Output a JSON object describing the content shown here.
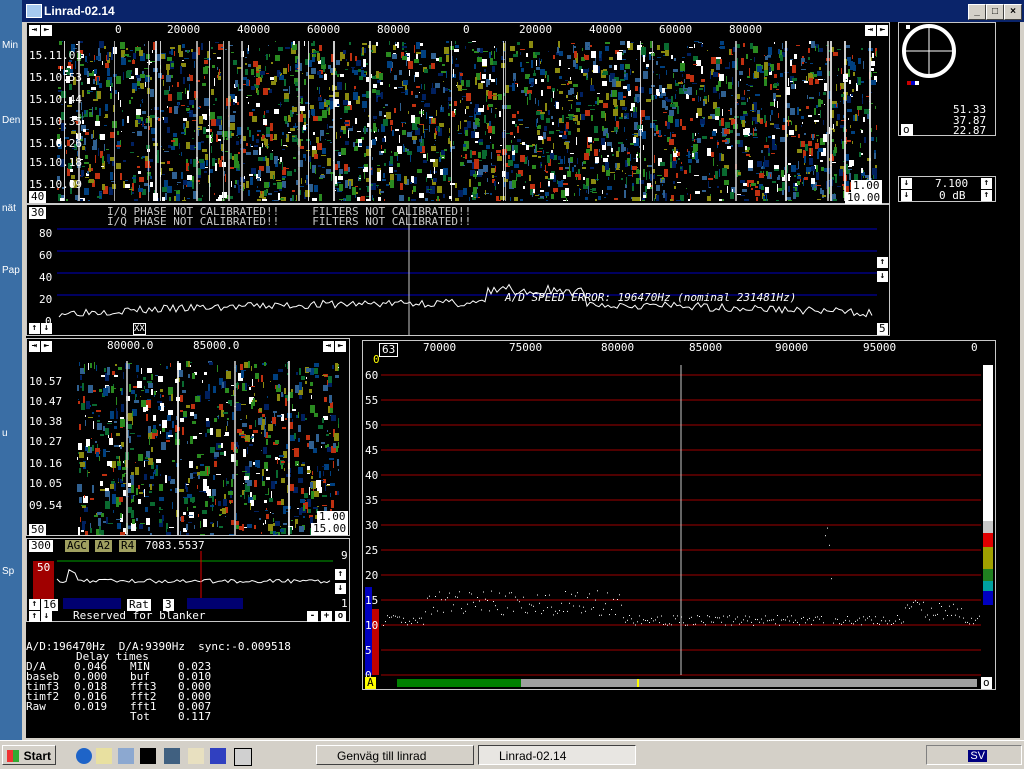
{
  "desktop_icons": [
    "Min",
    "Den",
    "nät",
    "Pap",
    "u",
    "Sp"
  ],
  "window": {
    "title": "Linrad-02.14"
  },
  "main_waterfall": {
    "freq_ticks": [
      "0",
      "20000",
      "40000",
      "60000",
      "80000",
      "0",
      "20000",
      "40000",
      "60000",
      "80000"
    ],
    "times": [
      "15.11.01",
      "15.10.53",
      "15.10.44",
      "15.10.35",
      "15.10.26",
      "15.10.18",
      "15.10.09"
    ],
    "left_box": "40",
    "right_box_top": "1.00",
    "right_box_bottom": "10.00"
  },
  "polar": {
    "values": [
      "51.33",
      "37.87",
      "22.87"
    ],
    "o_label": "o"
  },
  "gain_controls": {
    "row1": "7.100",
    "row2": "0 dB"
  },
  "spectrum": {
    "left_box": "30",
    "warning1": "I/Q PHASE NOT CALIBRATED!!     FILTERS NOT CALIBRATED!!",
    "warning2": "I/Q PHASE NOT CALIBRATED!!     FILTERS NOT CALIBRATED!!",
    "y_ticks": [
      "80",
      "60",
      "40",
      "20",
      "0"
    ],
    "speed_error": "A/D SPEED ERROR: 196470Hz (nominal 231481Hz)",
    "right_box": "5",
    "bottom_marker": "XX"
  },
  "small_waterfall": {
    "freq_ticks": [
      "80000.0",
      "85000.0"
    ],
    "times": [
      "10.57",
      "10.47",
      "10.38",
      "10.27",
      "10.16",
      "10.05",
      "09.54"
    ],
    "left_box": "50",
    "right_box_top": "1.00",
    "right_box_bottom": "15.00"
  },
  "baseband": {
    "box1": "300",
    "agc": "AGC",
    "a2": "A2",
    "r4": "R4",
    "freq": "7083.5537",
    "right_num": "9",
    "level": "50",
    "box_16": "16",
    "rat": "Rat",
    "rat_val": "3",
    "right_num2": "1",
    "reserved": "Reserved for blanker",
    "minus": "-",
    "plus": "+",
    "o": "o"
  },
  "stats": {
    "line1": "A/D:196470Hz  D/A:9390Hz  sync:-0.009518",
    "header": "Delay times",
    "rows": [
      [
        "D/A",
        "0.046",
        "MIN",
        "0.023"
      ],
      [
        "baseb",
        "0.000",
        "buf",
        "0.010"
      ],
      [
        "timf3",
        "0.018",
        "fft3",
        "0.000"
      ],
      [
        "timf2",
        "0.016",
        "fft2",
        "0.000"
      ],
      [
        "Raw",
        "0.019",
        "fft1",
        "0.007"
      ],
      [
        "",
        "",
        "Tot",
        "0.117"
      ]
    ]
  },
  "hires": {
    "top_box": "63",
    "freq_ticks": [
      "70000",
      "75000",
      "80000",
      "85000",
      "90000",
      "95000",
      "0"
    ],
    "y_ticks": [
      "60",
      "55",
      "50",
      "45",
      "40",
      "35",
      "30",
      "25",
      "20",
      "15",
      "10",
      "5",
      "0"
    ],
    "a_label": "A",
    "o_label": "o",
    "zero_label": "0"
  },
  "taskbar": {
    "start": "Start",
    "buttons": [
      "Genväg till linrad",
      "Linrad-02.14"
    ],
    "tray_text": "SV"
  },
  "colors": {
    "title_bar": "#0a246a",
    "desktop": "#3a6ea5",
    "grid_blue": "#0000c0",
    "grid_red": "#a00000"
  }
}
